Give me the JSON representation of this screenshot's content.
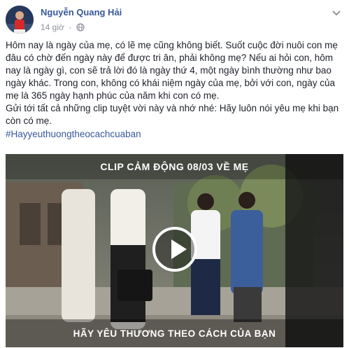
{
  "author": {
    "name": "Nguyễn Quang Hải",
    "time": "14 giờ",
    "separator": "·",
    "privacy_icon": "globe-icon"
  },
  "post": {
    "paragraphs": [
      "Hôm nay là ngày của mẹ, có lẽ mẹ cũng không biết. Suốt cuộc đời nuôi con mẹ đâu có chờ đến ngày này để được tri ân, phải không mẹ? Nếu ai hỏi con, hôm nay là ngày gì, con sẽ trả lời đó là ngày thứ 4, một ngày bình thường như bao ngày khác. Trong con, không có khái niệm ngày của mẹ, bởi với con, ngày của mẹ là 365 ngày hạnh phúc của năm khi con có mẹ.",
      "Gửi tới tất cả những clip tuyệt vời này và nhớ nhé: Hãy luôn nói yêu mẹ khi bạn còn có mẹ."
    ],
    "hashtag": "#Hayyeuthuongtheocachcuaban"
  },
  "video": {
    "title": "CLIP CẢM ĐỘNG 08/03 VỀ MẸ",
    "subtitle": "HÃY YÊU THƯƠNG THEO CÁCH CỦA BẠN",
    "play_icon": "play-icon"
  },
  "colors": {
    "link": "#365899",
    "meta": "#90949c",
    "text": "#1d2129"
  }
}
